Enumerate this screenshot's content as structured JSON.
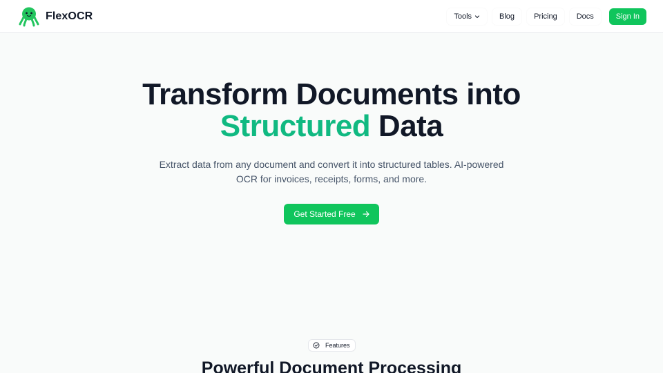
{
  "brand": {
    "name": "FlexOCR",
    "logo_icon": "octopus-icon",
    "logo_color": "#22c55e"
  },
  "nav": {
    "items": [
      {
        "label": "Tools",
        "has_dropdown": true
      },
      {
        "label": "Blog"
      },
      {
        "label": "Pricing"
      },
      {
        "label": "Docs"
      }
    ],
    "signin_label": "Sign In"
  },
  "hero": {
    "title_line1": "Transform Documents into",
    "title_accent": "Structured",
    "title_rest": " Data",
    "subtitle": "Extract data from any document and convert it into structured tables. AI-powered OCR for invoices, receipts, forms, and more.",
    "cta_label": "Get Started Free",
    "cta_icon": "arrow-right-icon"
  },
  "features": {
    "badge_label": "Features",
    "badge_icon": "check-circle-icon",
    "heading": "Powerful Document Processing"
  },
  "colors": {
    "primary": "#10c55c",
    "accent_text": "#10b981",
    "heading": "#111827",
    "body_text": "#475569",
    "background": "#f9fbfa"
  }
}
